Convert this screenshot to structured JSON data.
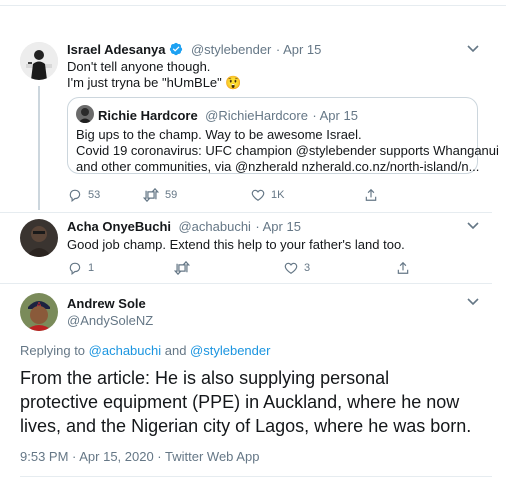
{
  "tweet1": {
    "name": "Israel Adesanya",
    "handle": "@stylebender",
    "date": "· Apr 15",
    "line1": "Don't tell anyone though.",
    "line2": "I'm just tryna be \"hUmBLe\"",
    "emoji": "😲",
    "quote": {
      "name": "Richie Hardcore",
      "handle": "@RichieHardcore",
      "date": "· Apr 15",
      "line1": "Big ups to the champ. Way to be awesome Israel.",
      "line2": "Covid 19 coronavirus: UFC champion @stylebender  supports Whanganui",
      "line3": "and other communities, via @nzherald nzherald.co.nz/north-island/n..."
    },
    "replies": "53",
    "retweets": "59",
    "likes": "1K"
  },
  "tweet2": {
    "name": "Acha OnyeBuchi",
    "handle": "@achabuchi",
    "date": "· Apr 15",
    "text": "Good job champ. Extend this help to your father's land too.",
    "replies": "1",
    "retweets": "",
    "likes": "3"
  },
  "tweet3": {
    "name": "Andrew Sole",
    "handle": "@AndySoleNZ",
    "replying_prefix": "Replying to ",
    "replying_user1": "@achabuchi",
    "replying_and": " and ",
    "replying_user2": "@stylebender",
    "line1": "From the article: He is also supplying personal",
    "line2": "protective equipment (PPE) in Auckland, where he now",
    "line3": "lives, and the Nigerian city of Lagos, where he was born.",
    "time": "9:53 PM · Apr 15, 2020 · ",
    "source": "Twitter Web App"
  },
  "colors": {
    "accent": "#1da1f2",
    "link": "#1b95e0",
    "secondary": "#657786",
    "border": "#e6ecf0"
  }
}
